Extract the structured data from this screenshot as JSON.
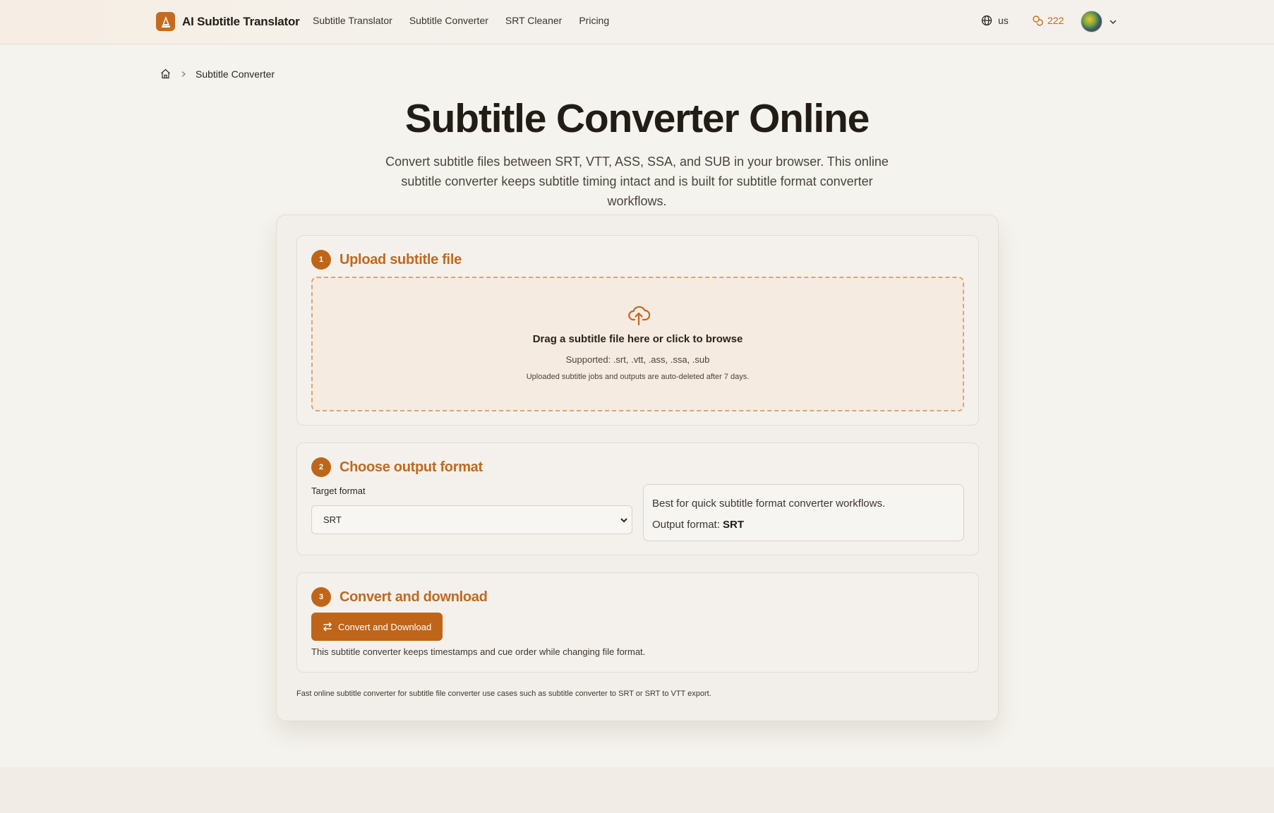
{
  "header": {
    "brand_name": "AI Subtitle Translator",
    "nav": [
      "Subtitle Translator",
      "Subtitle Converter",
      "SRT Cleaner",
      "Pricing"
    ],
    "language": "us",
    "credits": "222"
  },
  "breadcrumb": {
    "current": "Subtitle Converter"
  },
  "hero": {
    "title": "Subtitle Converter Online",
    "description": "Convert subtitle files between SRT, VTT, ASS, SSA, and SUB in your browser. This online subtitle converter keeps subtitle timing intact and is built for subtitle format converter workflows."
  },
  "steps": {
    "upload": {
      "number": "1",
      "title": "Upload subtitle file",
      "drop_text": "Drag a subtitle file here or click to browse",
      "supported": "Supported: .srt, .vtt, .ass, .ssa, .sub",
      "note": "Uploaded subtitle jobs and outputs are auto-deleted after 7 days."
    },
    "format": {
      "number": "2",
      "title": "Choose output format",
      "label": "Target format",
      "selected": "SRT",
      "info_line": "Best for quick subtitle format converter workflows.",
      "output_label": "Output format:",
      "output_value": "SRT"
    },
    "convert": {
      "number": "3",
      "title": "Convert and download",
      "button_label": "Convert and Download",
      "note": "This subtitle converter keeps timestamps and cue order while changing file format."
    }
  },
  "card_footer": "Fast online subtitle converter for subtitle file converter use cases such as subtitle converter to SRT or SRT to VTT export.",
  "colors": {
    "accent": "#bf6519",
    "accent_text": "#c0691f",
    "background": "#f5f3ee"
  },
  "icons": {
    "brand": "translator-logo-icon",
    "home": "home-icon",
    "breadcrumb_sep": "chevron-right-icon",
    "language": "globe-icon",
    "credits": "coins-icon",
    "account_menu": "chevron-down-icon",
    "upload": "cloud-upload-icon",
    "convert": "arrows-swap-icon"
  }
}
